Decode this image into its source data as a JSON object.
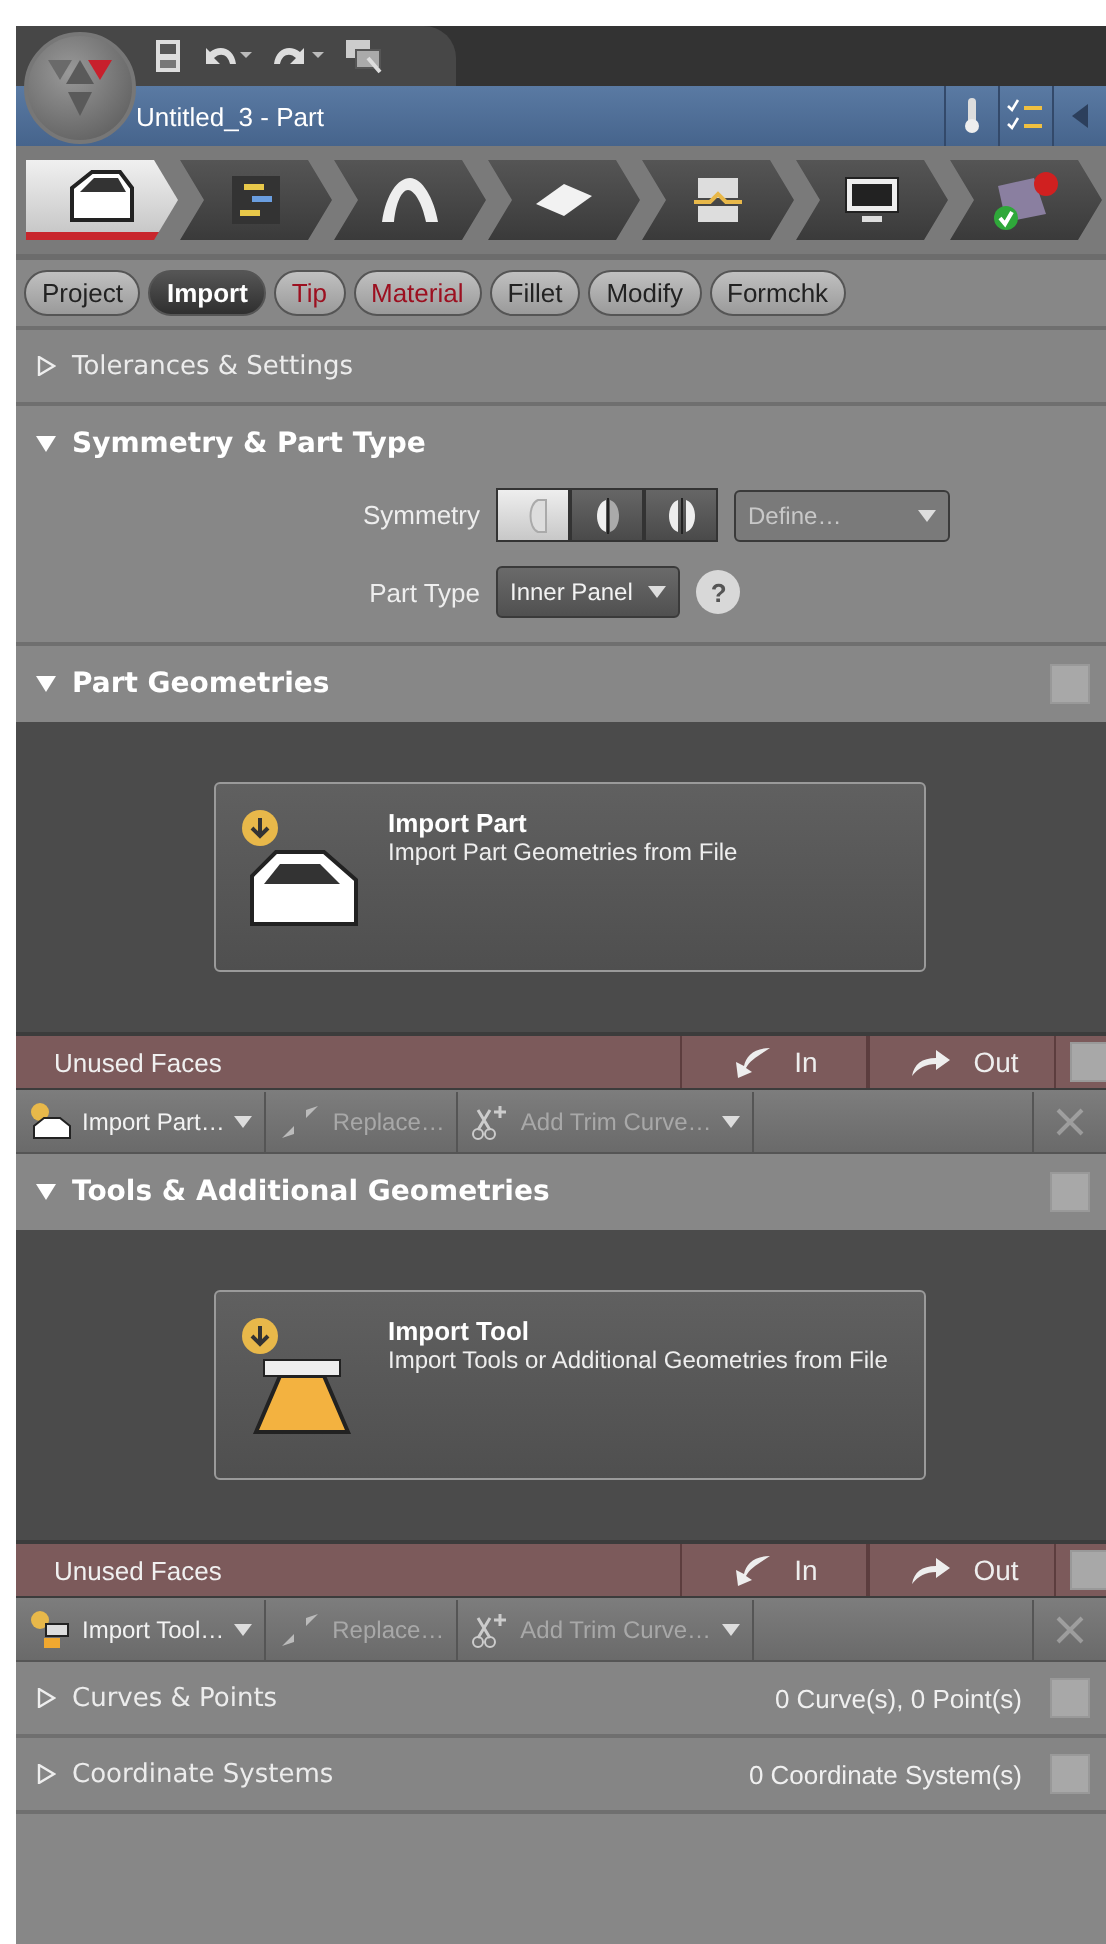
{
  "title_bar": {
    "title": "Untitled_3 -  Part"
  },
  "workflow_steps": [
    {
      "kind": "part",
      "selected": true
    },
    {
      "kind": "plan",
      "selected": false
    },
    {
      "kind": "surface",
      "selected": false
    },
    {
      "kind": "sheet",
      "selected": false
    },
    {
      "kind": "tool",
      "selected": false
    },
    {
      "kind": "monitor",
      "selected": false
    },
    {
      "kind": "check",
      "selected": false
    }
  ],
  "tabs": [
    {
      "label": "Project",
      "selected": false,
      "flagged": false
    },
    {
      "label": "Import",
      "selected": true,
      "flagged": false
    },
    {
      "label": "Tip",
      "selected": false,
      "flagged": true
    },
    {
      "label": "Material",
      "selected": false,
      "flagged": true
    },
    {
      "label": "Fillet",
      "selected": false,
      "flagged": false
    },
    {
      "label": "Modify",
      "selected": false,
      "flagged": false
    },
    {
      "label": "Formchk",
      "selected": false,
      "flagged": false
    }
  ],
  "tolerances": {
    "title": "Tolerances & Settings",
    "expanded": false
  },
  "symmetry_section": {
    "title": "Symmetry & Part Type",
    "expanded": true,
    "symmetry_label": "Symmetry",
    "symmetry_options": [
      {
        "kind": "none",
        "selected": true
      },
      {
        "kind": "half",
        "selected": false
      },
      {
        "kind": "full",
        "selected": false
      }
    ],
    "define": {
      "value": "Define…",
      "disabled": true
    },
    "part_type_label": "Part Type",
    "part_type": "Inner Panel",
    "help": "?"
  },
  "geometry_sections": [
    {
      "title": "Part Geometries",
      "expanded": true,
      "checked": false,
      "card": {
        "kind": "part",
        "title": "Import Part",
        "description": "Import Part Geometries from File"
      },
      "unused_faces": {
        "label": "Unused Faces",
        "in": "In",
        "out": "Out",
        "checked": false
      },
      "toolbar": [
        {
          "kind": "import-part",
          "label": "Import Part…",
          "disabled": false,
          "dropdown": true
        },
        {
          "kind": "replace",
          "label": "Replace…",
          "disabled": true,
          "dropdown": false
        },
        {
          "kind": "trim",
          "label": "Add Trim Curve…",
          "disabled": true,
          "dropdown": true
        }
      ],
      "delete_disabled": true
    },
    {
      "title": "Tools & Additional Geometries",
      "expanded": true,
      "checked": false,
      "card": {
        "kind": "tool",
        "title": "Import Tool",
        "description": "Import Tools or Additional Geometries from File"
      },
      "unused_faces": {
        "label": "Unused Faces",
        "in": "In",
        "out": "Out",
        "checked": false
      },
      "toolbar": [
        {
          "kind": "import-tool",
          "label": "Import Tool…",
          "disabled": false,
          "dropdown": true
        },
        {
          "kind": "replace",
          "label": "Replace…",
          "disabled": true,
          "dropdown": false
        },
        {
          "kind": "trim",
          "label": "Add Trim Curve…",
          "disabled": true,
          "dropdown": true
        }
      ],
      "delete_disabled": true
    }
  ],
  "summary_sections": [
    {
      "title": "Curves & Points",
      "summary": "0 Curve(s), 0 Point(s)",
      "expanded": false,
      "checked": false
    },
    {
      "title": "Coordinate Systems",
      "summary": "0 Coordinate System(s)",
      "expanded": false,
      "checked": false
    }
  ]
}
